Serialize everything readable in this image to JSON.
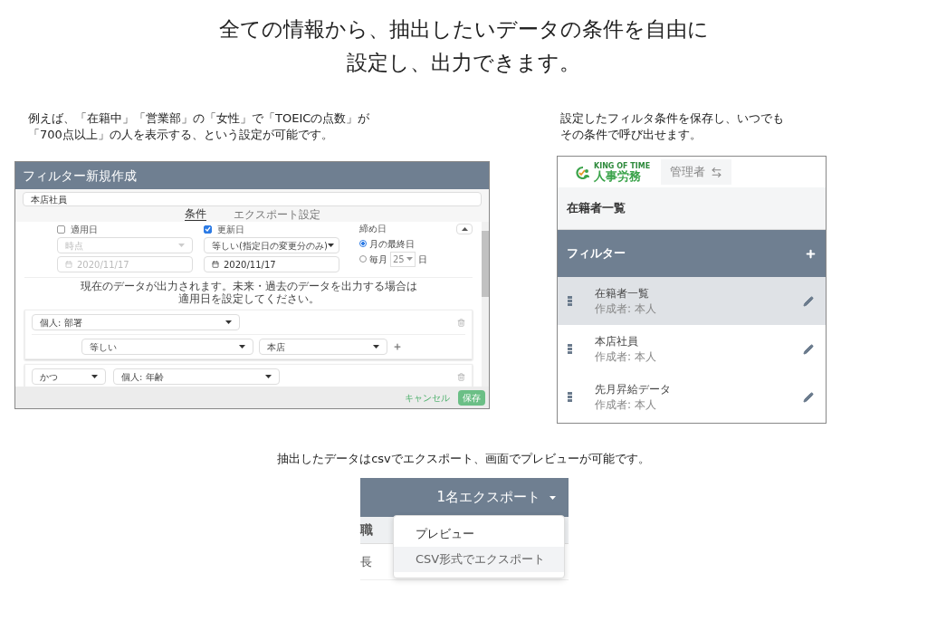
{
  "headline": [
    "全ての情報から、抽出したいデータの条件を自由に",
    "設定し、出力できます。"
  ],
  "filter_section": {
    "caption": [
      "例えば、「在籍中」「営業部」の「女性」で「TOEICの点数」が",
      "「700点以上」の人を表示する、という設定が可能です。"
    ],
    "modal": {
      "title": "フィルター新規作成",
      "name_value": "本店社員",
      "tabs": [
        {
          "label": "条件",
          "selected": true
        },
        {
          "label": "エクスポート設定",
          "selected": false
        }
      ],
      "date_options": [
        {
          "label": "適用日",
          "checked": false,
          "select": "時点",
          "date": "2020/11/17"
        },
        {
          "label": "更新日",
          "checked": true,
          "select": "等しい(指定日の変更分のみ)",
          "date": "2020/11/17"
        }
      ],
      "closing": {
        "label": "締め日",
        "options": [
          {
            "label": "月の最終日",
            "selected": true
          },
          {
            "label": "毎月",
            "selected": false,
            "day": "25",
            "suffix": "日"
          }
        ]
      },
      "notice": [
        "現在のデータが出力されます。未来・過去のデータを出力する場合は",
        "適用日を設定してください。"
      ],
      "conditions": [
        {
          "field": "個人: 部署",
          "operator": "等しい",
          "value": "本店"
        },
        {
          "connector": "かつ",
          "field": "個人: 年齢"
        }
      ],
      "cancel": "キャンセル",
      "save": "保存"
    }
  },
  "saved_section": {
    "caption": [
      "設定したフィルタ条件を保存し、いつでも",
      "その条件で呼び出せます。"
    ],
    "logo_tagline": "KING OF TIME",
    "logo_text": "人事労務",
    "role": "管理者",
    "page_title": "在籍者一覧",
    "filter_header": "フィルター",
    "filters": [
      {
        "name": "在籍者一覧",
        "creator": "作成者: 本人",
        "selected": true
      },
      {
        "name": "本店社員",
        "creator": "作成者: 本人",
        "selected": false
      },
      {
        "name": "先月昇給データ",
        "creator": "作成者: 本人",
        "selected": false
      }
    ]
  },
  "export_section": {
    "caption": "抽出したデータはcsvでエクスポート、画面でプレビューが可能です。",
    "export_button": "1名エクスポート",
    "column_header": "職",
    "cell": "長",
    "menu": [
      {
        "label": "プレビュー",
        "selected": false
      },
      {
        "label": "CSV形式でエクスポート",
        "selected": true
      }
    ]
  }
}
